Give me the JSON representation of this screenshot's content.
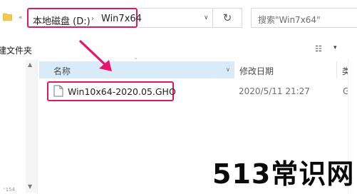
{
  "address_bar": {
    "overflow_glyph": "«",
    "crumbs": [
      "本地磁盘 (D:)",
      "Win7x64"
    ],
    "separator": "›",
    "dropdown_glyph": "∨",
    "refresh_glyph": "↻"
  },
  "search": {
    "placeholder": "搜索\"Win7x64\""
  },
  "toolbar": {
    "nav_label": "建文件夹",
    "view_glyph": "☷",
    "view_dropdown_glyph": "▾"
  },
  "columns": {
    "name": "名称",
    "date": "修改日期",
    "type": "类",
    "sort_glyph": "⌃",
    "dropdown_glyph": "∨"
  },
  "files": [
    {
      "name": "Win10x64-2020.05.GHO",
      "date": "2020/5/11 21:27",
      "type": "GH"
    }
  ],
  "scrollbar": {
    "up_glyph": "▲",
    "down_glyph": "▼"
  },
  "nav_footer": "⁺154",
  "watermark": "513常识网",
  "colors": {
    "highlight_border": "#e0195a",
    "arrow": "#e8156a",
    "header_hover": "#d9ebf9",
    "folder": "#f2c94c"
  }
}
